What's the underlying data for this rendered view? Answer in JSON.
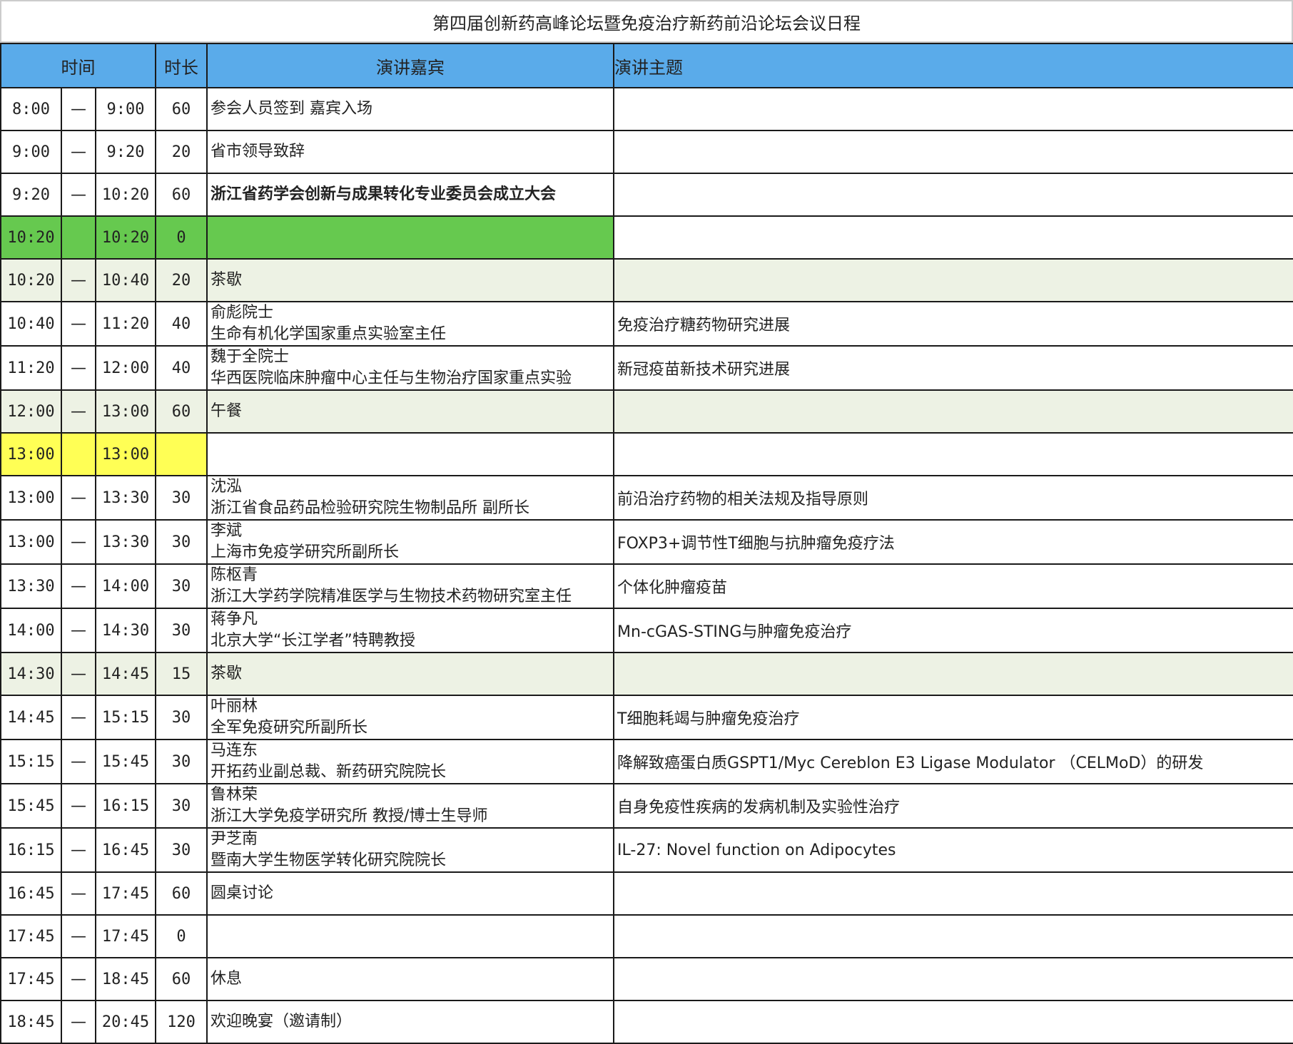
{
  "title": "第四届创新药高峰论坛暨免疫治疗新药前沿论坛会议日程",
  "headers": {
    "time": "时间",
    "duration": "时长",
    "speaker": "演讲嘉宾",
    "topic": "演讲主题"
  },
  "rows": [
    {
      "start": "8:00",
      "dash": "—",
      "end": "9:00",
      "dur": "60",
      "speaker1": "参会人员签到 嘉宾入场",
      "speaker2": "",
      "topic": ""
    },
    {
      "start": "9:00",
      "dash": "—",
      "end": "9:20",
      "dur": "20",
      "speaker1": "省市领导致辞",
      "speaker2": "",
      "topic": ""
    },
    {
      "start": "9:20",
      "dash": "—",
      "end": "10:20",
      "dur": "60",
      "speaker1": "浙江省药学会创新与成果转化专业委员会成立大会",
      "speaker2": "",
      "topic": ""
    },
    {
      "start": "10:20",
      "dash": "",
      "end": "10:20",
      "dur": "0",
      "speaker1": "",
      "speaker2": "",
      "topic": ""
    },
    {
      "start": "10:20",
      "dash": "—",
      "end": "10:40",
      "dur": "20",
      "speaker1": "茶歇",
      "speaker2": "",
      "topic": ""
    },
    {
      "start": "10:40",
      "dash": "—",
      "end": "11:20",
      "dur": "40",
      "speaker1": "俞彪院士",
      "speaker2": "生命有机化学国家重点实验室主任",
      "topic": "免疫治疗糖药物研究进展"
    },
    {
      "start": "11:20",
      "dash": "—",
      "end": "12:00",
      "dur": "40",
      "speaker1": "魏于全院士",
      "speaker2": "华西医院临床肿瘤中心主任与生物治疗国家重点实验",
      "topic": "新冠疫苗新技术研究进展"
    },
    {
      "start": "12:00",
      "dash": "—",
      "end": "13:00",
      "dur": "60",
      "speaker1": "午餐",
      "speaker2": "",
      "topic": ""
    },
    {
      "start": "13:00",
      "dash": "",
      "end": "13:00",
      "dur": "",
      "speaker1": "",
      "speaker2": "",
      "topic": ""
    },
    {
      "start": "13:00",
      "dash": "—",
      "end": "13:30",
      "dur": "30",
      "speaker1": "沈泓",
      "speaker2": "浙江省食品药品检验研究院生物制品所 副所长",
      "topic": "前沿治疗药物的相关法规及指导原则"
    },
    {
      "start": "13:00",
      "dash": "—",
      "end": "13:30",
      "dur": "30",
      "speaker1": "李斌",
      "speaker2": "上海市免疫学研究所副所长",
      "topic": "FOXP3+调节性T细胞与抗肿瘤免疫疗法"
    },
    {
      "start": "13:30",
      "dash": "—",
      "end": "14:00",
      "dur": "30",
      "speaker1": "陈枢青",
      "speaker2": "浙江大学药学院精准医学与生物技术药物研究室主任",
      "topic": "个体化肿瘤疫苗"
    },
    {
      "start": "14:00",
      "dash": "—",
      "end": "14:30",
      "dur": "30",
      "speaker1": "蒋争凡",
      "speaker2": "北京大学“长江学者”特聘教授",
      "topic": "Mn-cGAS-STING与肿瘤免疫治疗"
    },
    {
      "start": "14:30",
      "dash": "—",
      "end": "14:45",
      "dur": "15",
      "speaker1": "茶歇",
      "speaker2": "",
      "topic": ""
    },
    {
      "start": "14:45",
      "dash": "—",
      "end": "15:15",
      "dur": "30",
      "speaker1": "叶丽林",
      "speaker2": "全军免疫研究所副所长",
      "topic": "T细胞耗竭与肿瘤免疫治疗"
    },
    {
      "start": "15:15",
      "dash": "—",
      "end": "15:45",
      "dur": "30",
      "speaker1": "马连东",
      "speaker2": "开拓药业副总裁、新药研究院院长",
      "topic": "降解致癌蛋白质GSPT1/Myc Cereblon E3 Ligase Modulator （CELMoD）的研发"
    },
    {
      "start": "15:45",
      "dash": "—",
      "end": "16:15",
      "dur": "30",
      "speaker1": "鲁林荣",
      "speaker2": "浙江大学免疫学研究所 教授/博士生导师",
      "topic": "自身免疫性疾病的发病机制及实验性治疗"
    },
    {
      "start": "16:15",
      "dash": "—",
      "end": "16:45",
      "dur": "30",
      "speaker1": "尹芝南",
      "speaker2": "暨南大学生物医学转化研究院院长",
      "topic": "IL-27: Novel function on Adipocytes"
    },
    {
      "start": "16:45",
      "dash": "—",
      "end": "17:45",
      "dur": "60",
      "speaker1": "圆桌讨论",
      "speaker2": "",
      "topic": ""
    },
    {
      "start": "17:45",
      "dash": "—",
      "end": "17:45",
      "dur": "0",
      "speaker1": "",
      "speaker2": "",
      "topic": ""
    },
    {
      "start": "17:45",
      "dash": "—",
      "end": "18:45",
      "dur": "60",
      "speaker1": "休息",
      "speaker2": "",
      "topic": ""
    },
    {
      "start": "18:45",
      "dash": "—",
      "end": "20:45",
      "dur": "120",
      "speaker1": "欢迎晚宴（邀请制）",
      "speaker2": "",
      "topic": ""
    }
  ]
}
